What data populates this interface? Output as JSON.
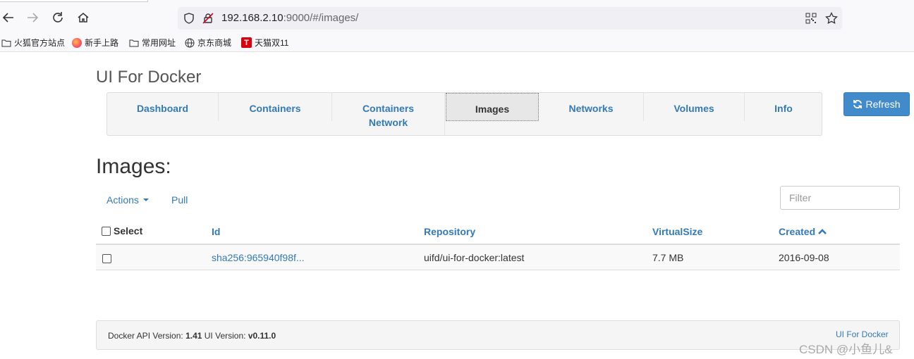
{
  "browser": {
    "url_host": "192.168.2.10",
    "url_rest": ":9000/#/images/",
    "bookmarks": [
      "火狐官方站点",
      "新手上路",
      "常用网址",
      "京东商城",
      "天猫双11"
    ]
  },
  "app": {
    "title": "UI For Docker",
    "tabs": [
      {
        "label": "Dashboard"
      },
      {
        "label": "Containers"
      },
      {
        "label": "Containers Network"
      },
      {
        "label": "Images"
      },
      {
        "label": "Networks"
      },
      {
        "label": "Volumes"
      },
      {
        "label": "Info"
      }
    ],
    "active_tab": "Images",
    "refresh_label": "Refresh"
  },
  "page": {
    "heading": "Images:",
    "actions_label": "Actions",
    "pull_label": "Pull",
    "filter_placeholder": "Filter"
  },
  "table": {
    "columns": [
      "Select",
      "Id",
      "Repository",
      "VirtualSize",
      "Created"
    ],
    "rows": [
      {
        "id": "sha256:965940f98f...",
        "repository": "uifd/ui-for-docker:latest",
        "size": "7.7 MB",
        "created": "2016-09-08"
      }
    ]
  },
  "footer": {
    "api_label": "Docker API Version:",
    "api_version": "1.41",
    "ui_label": "UI Version:",
    "ui_version": "v0.11.0",
    "link": "UI For Docker"
  },
  "watermark": "CSDN @小鱼儿&",
  "colors": {
    "link": "#337ab7",
    "primary_button": "#428bca"
  }
}
